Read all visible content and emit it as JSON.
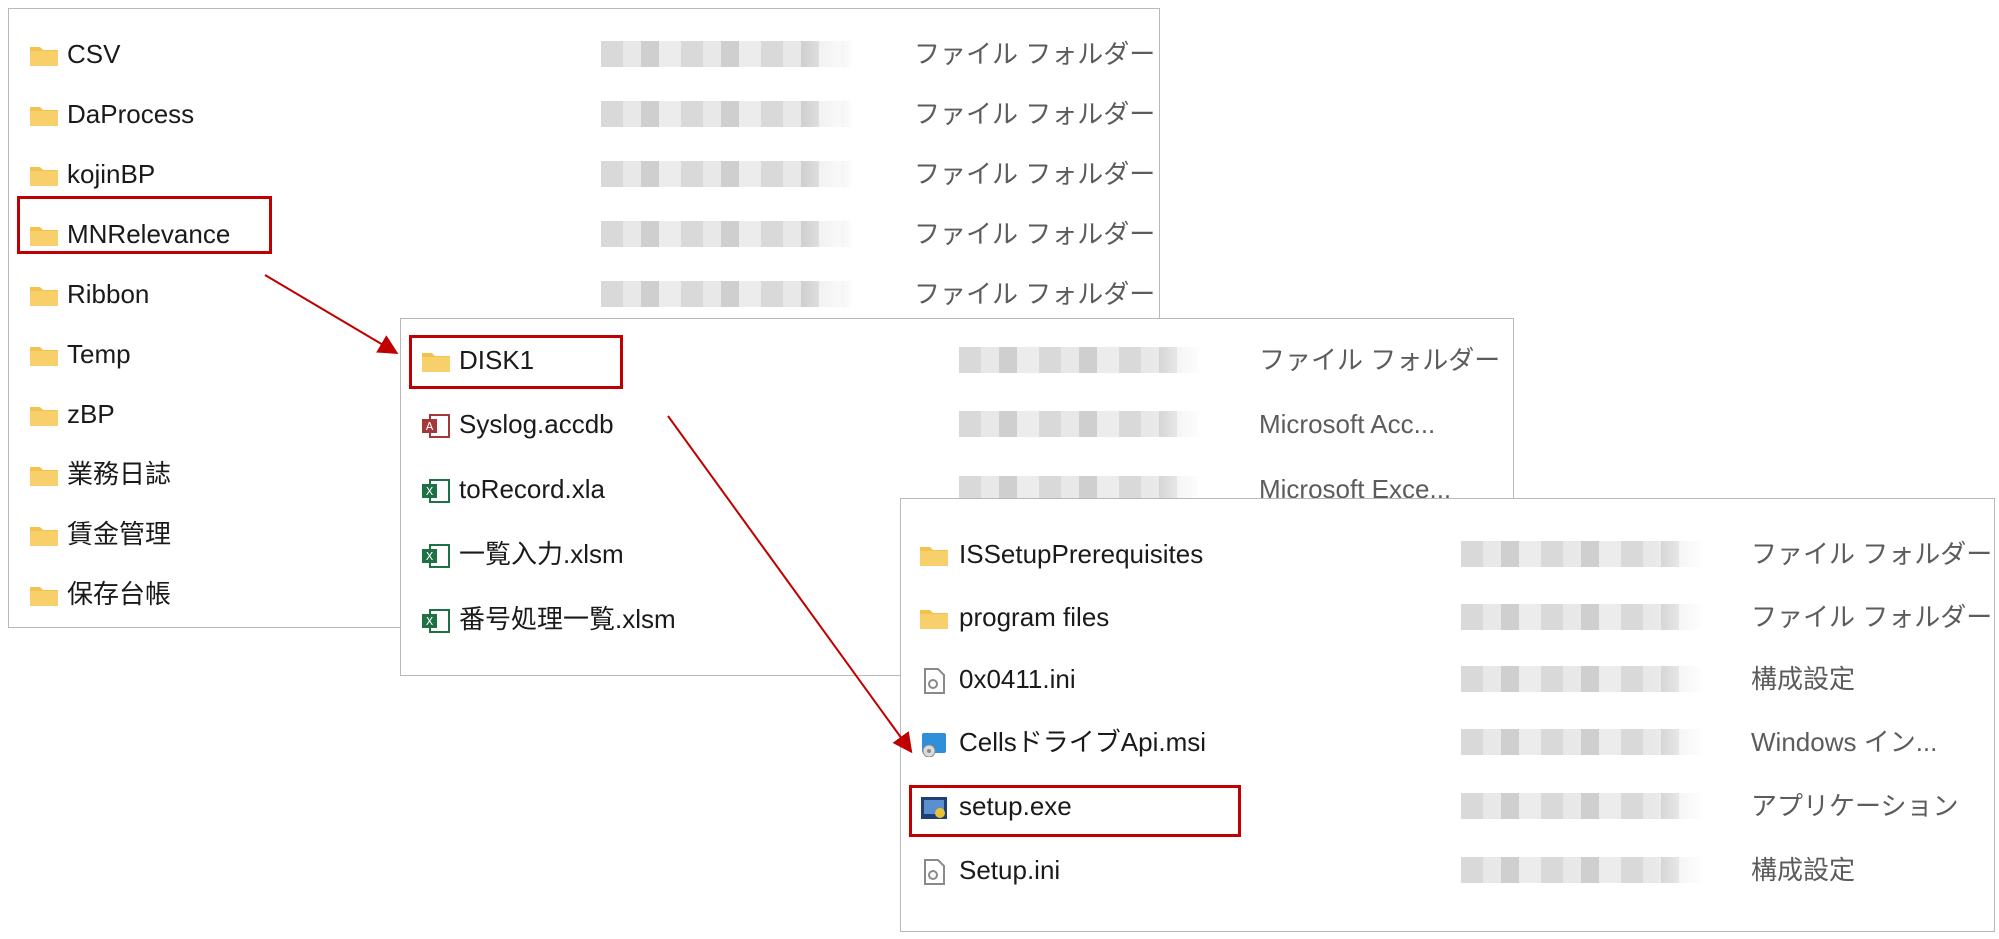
{
  "colors": {
    "highlight": "#c00000",
    "folder": "#f2c14e",
    "type_text": "#5c5c5c"
  },
  "panel1": {
    "rows": [
      {
        "name": "CSV",
        "type": "ファイル フォルダー",
        "icon": "folder-icon"
      },
      {
        "name": "DaProcess",
        "type": "ファイル フォルダー",
        "icon": "folder-icon"
      },
      {
        "name": "kojinBP",
        "type": "ファイル フォルダー",
        "icon": "folder-icon"
      },
      {
        "name": "MNRelevance",
        "type": "ファイル フォルダー",
        "icon": "folder-icon"
      },
      {
        "name": "Ribbon",
        "type": "ファイル フォルダー",
        "icon": "folder-icon"
      },
      {
        "name": "Temp",
        "type": "",
        "icon": "folder-icon"
      },
      {
        "name": "zBP",
        "type": "",
        "icon": "folder-icon"
      },
      {
        "name": "業務日誌",
        "type": "",
        "icon": "folder-icon"
      },
      {
        "name": "賃金管理",
        "type": "",
        "icon": "folder-icon"
      },
      {
        "name": "保存台帳",
        "type": "",
        "icon": "folder-icon"
      }
    ]
  },
  "panel2": {
    "rows": [
      {
        "name": "DISK1",
        "type": "ファイル フォルダー",
        "icon": "folder-icon"
      },
      {
        "name": "Syslog.accdb",
        "type": "Microsoft Acc...",
        "icon": "access-file-icon"
      },
      {
        "name": "toRecord.xla",
        "type": "Microsoft Exce...",
        "icon": "excel-addin-icon"
      },
      {
        "name": "一覧入力.xlsm",
        "type": "",
        "icon": "excel-macro-icon"
      },
      {
        "name": "番号処理一覧.xlsm",
        "type": "",
        "icon": "excel-macro-icon"
      }
    ]
  },
  "panel3": {
    "rows": [
      {
        "name": "ISSetupPrerequisites",
        "type": "ファイル フォルダー",
        "icon": "folder-icon"
      },
      {
        "name": "program files",
        "type": "ファイル フォルダー",
        "icon": "folder-icon"
      },
      {
        "name": "0x0411.ini",
        "type": "構成設定",
        "icon": "ini-file-icon"
      },
      {
        "name": "CellsドライブApi.msi",
        "type": "Windows イン...",
        "icon": "msi-file-icon"
      },
      {
        "name": "setup.exe",
        "type": "アプリケーション",
        "icon": "setup-exe-icon"
      },
      {
        "name": "Setup.ini",
        "type": "構成設定",
        "icon": "ini-file-icon"
      }
    ]
  }
}
